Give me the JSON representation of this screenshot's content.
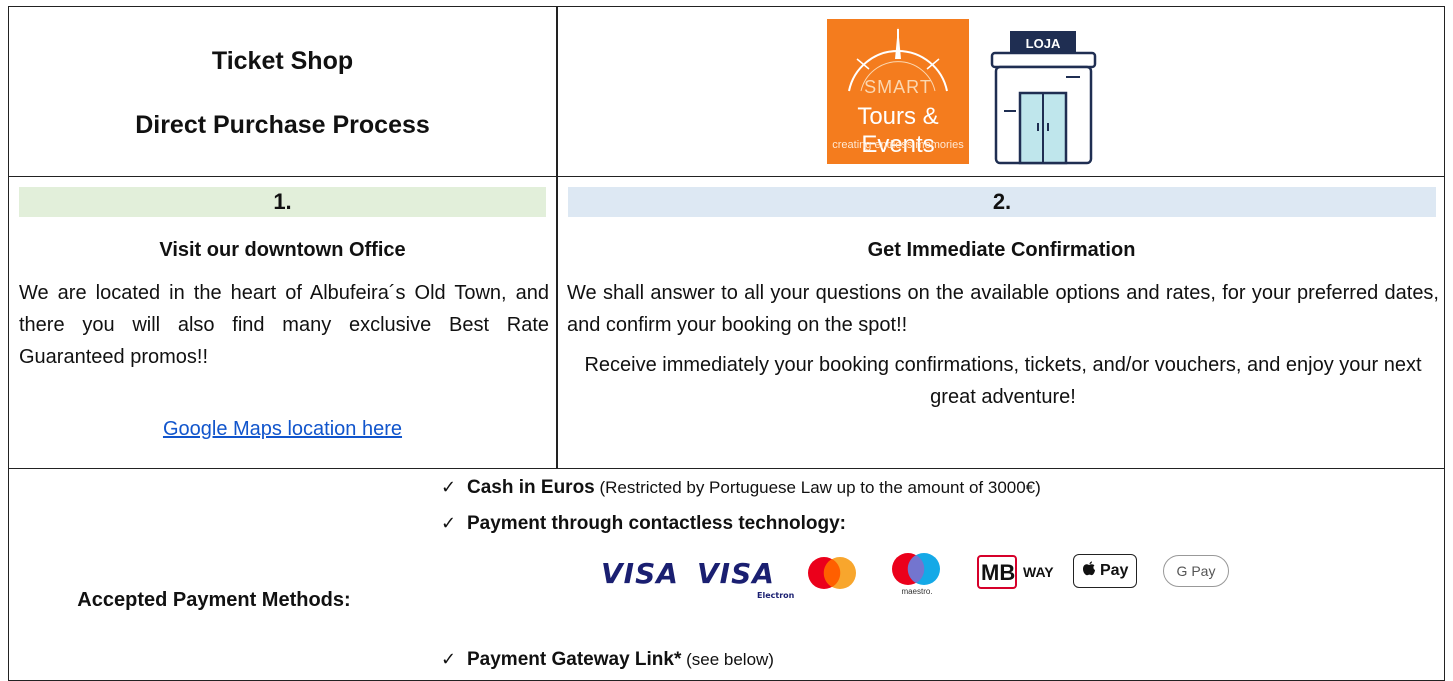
{
  "header": {
    "title_line1": "Ticket Shop",
    "title_line2": "Direct Purchase Process",
    "logo": {
      "word1": "SMART",
      "word2": "Tours & Events",
      "tagline": "creating endless memories",
      "brand_color": "#f47c1e"
    },
    "shop_sign": "LOJA"
  },
  "step1": {
    "number": "1.",
    "title": "Visit our downtown Office",
    "body": "We are located in the heart of Albufeira´s Old Town, and there you will also find many exclusive Best Rate Guaranteed promos!!",
    "link_text": "Google Maps location here",
    "band_color": "#e2efda"
  },
  "step2": {
    "number": "2.",
    "title": "Get Immediate Confirmation",
    "body1": "We shall answer to all your questions on the available options and rates, for your preferred dates, and confirm your booking on the spot!!",
    "body2": "Receive immediately your booking confirmations, tickets, and/or vouchers, and enjoy your next great adventure!",
    "band_color": "#dde8f3"
  },
  "payment": {
    "label": "Accepted Payment Methods:",
    "items": [
      {
        "bold": "Cash in Euros",
        "rest": " (Restricted by Portuguese Law up to the amount of 3000€)"
      },
      {
        "bold": "Payment through contactless technology:",
        "rest": ""
      },
      {
        "bold": "Payment Gateway Link*",
        "rest": " (see below)"
      }
    ],
    "cards": {
      "visa": "VISA",
      "visa_electron": "VISA",
      "electron_sub": "Electron",
      "maestro_sub": "maestro.",
      "mbway_logo": "MB",
      "mbway_word": "WAY",
      "apple_pay": "Pay",
      "google_pay": "G Pay"
    },
    "icons": [
      "checkmark-icon",
      "mastercard-icon",
      "maestro-icon",
      "apple-icon"
    ]
  }
}
